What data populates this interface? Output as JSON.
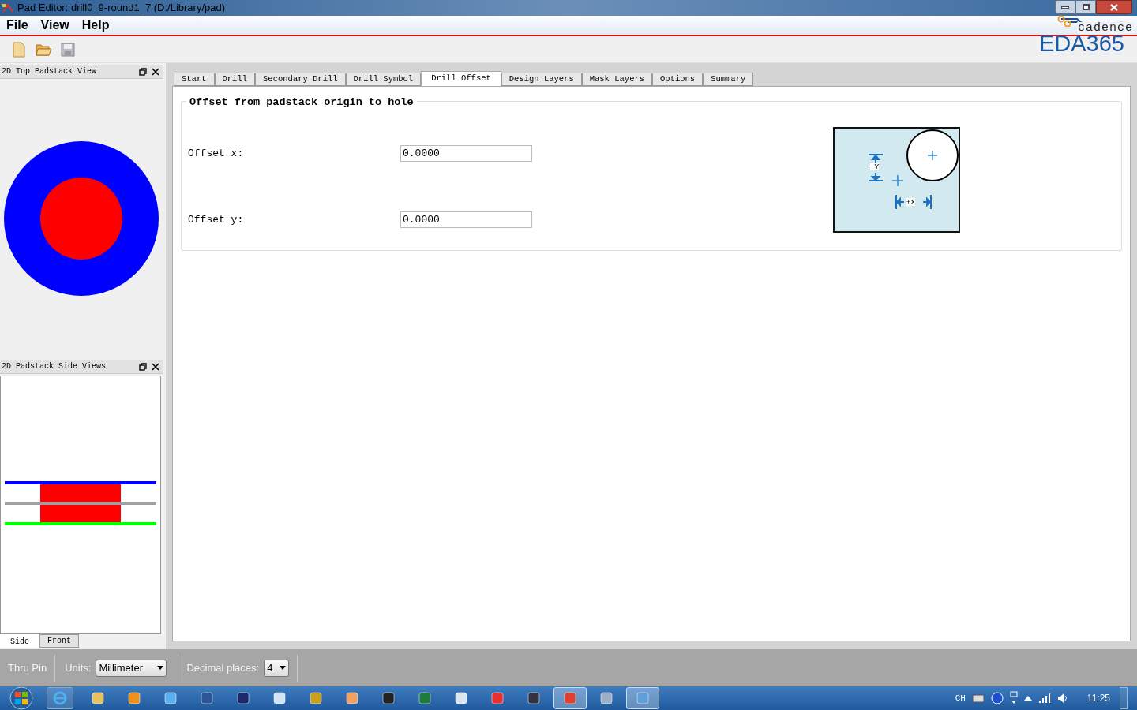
{
  "window": {
    "title": "Pad Editor: drill0_9-round1_7  (D:/Library/pad)"
  },
  "menu": [
    "File",
    "View",
    "Help"
  ],
  "logo": {
    "brand": "cadence",
    "site": "EDA365"
  },
  "top_view": {
    "title": "2D Top Padstack View"
  },
  "side_view": {
    "title": "2D Padstack Side Views",
    "tabs": [
      {
        "label": "Side",
        "selected": true
      },
      {
        "label": "Front",
        "selected": false
      }
    ]
  },
  "tabs": [
    {
      "label": "Start",
      "selected": false
    },
    {
      "label": "Drill",
      "selected": false
    },
    {
      "label": "Secondary Drill",
      "selected": false
    },
    {
      "label": "Drill Symbol",
      "selected": false
    },
    {
      "label": "Drill Offset",
      "selected": true
    },
    {
      "label": "Design Layers",
      "selected": false
    },
    {
      "label": "Mask Layers",
      "selected": false
    },
    {
      "label": "Options",
      "selected": false
    },
    {
      "label": "Summary",
      "selected": false
    }
  ],
  "group": {
    "title": "Offset from padstack origin to hole",
    "fields": [
      {
        "label": "Offset x:",
        "value": "0.0000"
      },
      {
        "label": "Offset y:",
        "value": "0.0000"
      }
    ],
    "diagram": {
      "y_label": "+Y",
      "x_label": "+X"
    }
  },
  "status_bar": {
    "mode": "Thru Pin",
    "units_label": "Units:",
    "units": "Millimeter",
    "decimal_label": "Decimal places:",
    "decimal": "4"
  },
  "taskbar": {
    "apps": [
      {
        "kind": "folder",
        "active": false
      },
      {
        "kind": "media",
        "active": false
      },
      {
        "kind": "cloud",
        "active": false
      },
      {
        "kind": "word",
        "active": false
      },
      {
        "kind": "ps",
        "active": false
      },
      {
        "kind": "notepad",
        "active": false
      },
      {
        "kind": "globe",
        "active": false
      },
      {
        "kind": "paint",
        "active": false
      },
      {
        "kind": "penguin",
        "active": false
      },
      {
        "kind": "excel",
        "active": false
      },
      {
        "kind": "calc",
        "active": false
      },
      {
        "kind": "chip",
        "active": false
      },
      {
        "kind": "viewer",
        "active": false
      },
      {
        "kind": "pad",
        "active": true
      },
      {
        "kind": "bird",
        "active": false
      },
      {
        "kind": "window",
        "active": true
      }
    ],
    "input_lang": "CH",
    "clock": "11:25"
  }
}
